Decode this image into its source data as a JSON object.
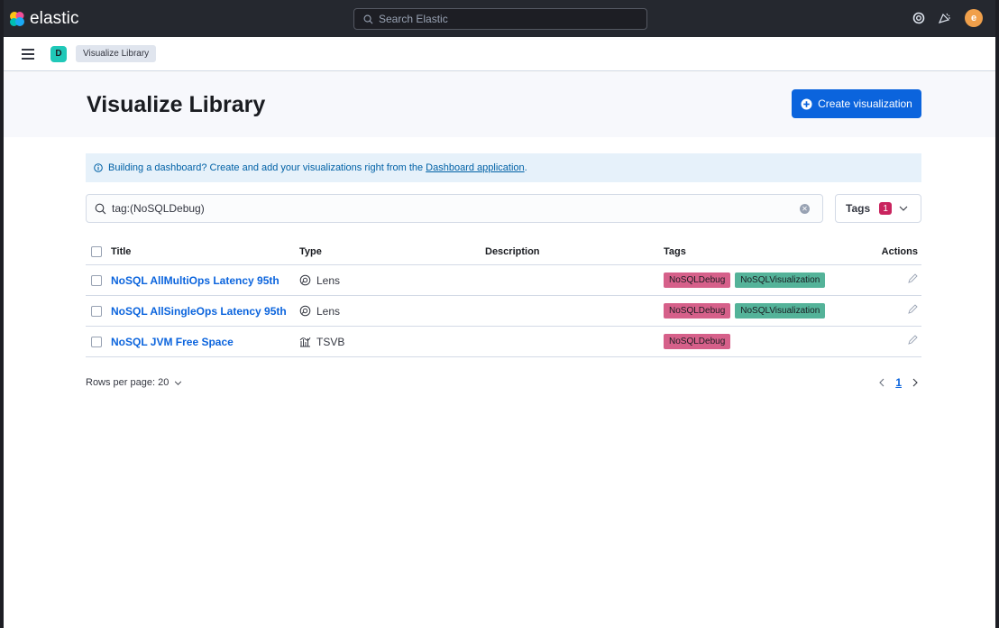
{
  "app": {
    "brand": "elastic",
    "search_placeholder": "Search Elastic",
    "user_initial": "e",
    "space_initial": "D"
  },
  "breadcrumb": {
    "current": "Visualize Library"
  },
  "page": {
    "title": "Visualize Library",
    "create_label": "Create visualization"
  },
  "callout": {
    "text": "Building a dashboard? Create and add your visualizations right from the",
    "link": "Dashboard application",
    "trailing": "."
  },
  "search": {
    "query": "tag:(NoSQLDebug)",
    "tags_label": "Tags",
    "tags_count": "1"
  },
  "table": {
    "headers": {
      "title": "Title",
      "type": "Type",
      "description": "Description",
      "tags": "Tags",
      "actions": "Actions"
    },
    "rows": [
      {
        "title": "NoSQL AllMultiOps Latency 95th",
        "type": "Lens",
        "type_icon": "lens-icon",
        "description": "",
        "tags": [
          "NoSQLDebug",
          "NoSQLVisualization"
        ]
      },
      {
        "title": "NoSQL AllSingleOps Latency 95th",
        "type": "Lens",
        "type_icon": "lens-icon",
        "description": "",
        "tags": [
          "NoSQLDebug",
          "NoSQLVisualization"
        ]
      },
      {
        "title": "NoSQL JVM Free Space",
        "type": "TSVB",
        "type_icon": "tsvb-icon",
        "description": "",
        "tags": [
          "NoSQLDebug"
        ]
      }
    ]
  },
  "footer": {
    "rows_per_page": "Rows per page: 20",
    "current_page": "1"
  },
  "colors": {
    "topbar": "#25282f",
    "primary": "#0b64dd",
    "tag_debug": "#d6608a",
    "tag_viz": "#54b399",
    "callout_bg": "#e6f1fa"
  }
}
